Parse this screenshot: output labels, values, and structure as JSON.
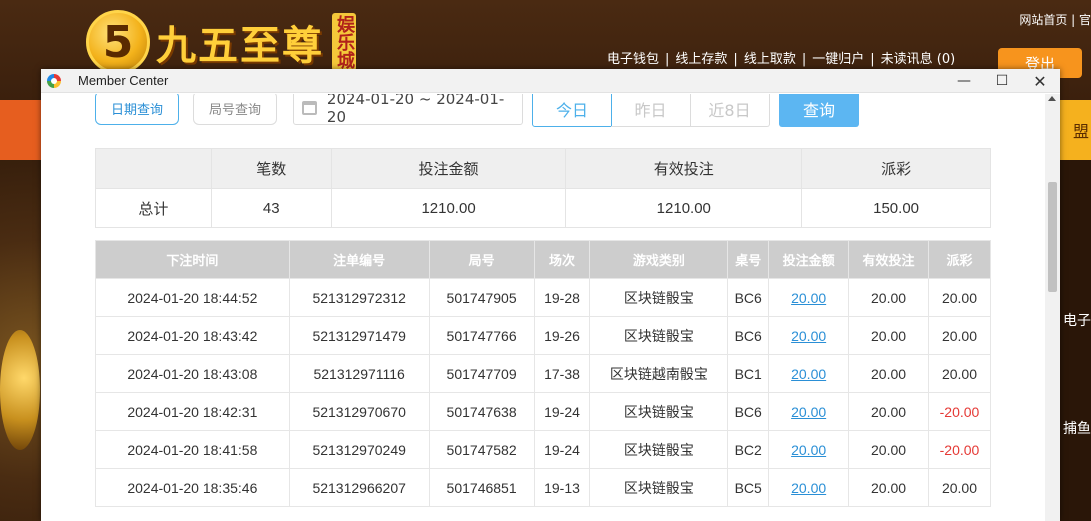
{
  "site": {
    "logo_mark": "5",
    "logo_text": "九五至尊",
    "logo_tag": "娱乐城",
    "top_links": "网站首页 | 官",
    "user_nav": [
      "电子钱包",
      "线上存款",
      "线上取款",
      "一键归户",
      "未读讯息 (0)"
    ],
    "logout_label": "登出",
    "band_right_text": "盟",
    "right_icon_labels": [
      "电子",
      "捕鱼"
    ]
  },
  "window": {
    "title": "Member Center",
    "minimize_icon": "—",
    "maximize_icon": "☐",
    "close_icon": "✕"
  },
  "filter": {
    "tab_date": "日期查询",
    "tab_round": "局号查询",
    "date_range": "2024-01-20 ~ 2024-01-20",
    "today": "今日",
    "yesterday": "昨日",
    "last8": "近8日",
    "query": "查询"
  },
  "summary": {
    "headers": [
      "",
      "笔数",
      "投注金额",
      "有效投注",
      "派彩"
    ],
    "row": [
      "总计",
      "43",
      "1210.00",
      "1210.00",
      "150.00"
    ]
  },
  "detail": {
    "headers": [
      "下注时间",
      "注单编号",
      "局号",
      "场次",
      "游戏类别",
      "桌号",
      "投注金额",
      "有效投注",
      "派彩"
    ],
    "rows": [
      [
        "2024-01-20 18:44:52",
        "521312972312",
        "501747905",
        "19-28",
        "区块链骰宝",
        "BC6",
        "20.00",
        "20.00",
        "20.00"
      ],
      [
        "2024-01-20 18:43:42",
        "521312971479",
        "501747766",
        "19-26",
        "区块链骰宝",
        "BC6",
        "20.00",
        "20.00",
        "20.00"
      ],
      [
        "2024-01-20 18:43:08",
        "521312971116",
        "501747709",
        "17-38",
        "区块链越南骰宝",
        "BC1",
        "20.00",
        "20.00",
        "20.00"
      ],
      [
        "2024-01-20 18:42:31",
        "521312970670",
        "501747638",
        "19-24",
        "区块链骰宝",
        "BC6",
        "20.00",
        "20.00",
        "-20.00"
      ],
      [
        "2024-01-20 18:41:58",
        "521312970249",
        "501747582",
        "19-24",
        "区块链骰宝",
        "BC2",
        "20.00",
        "20.00",
        "-20.00"
      ],
      [
        "2024-01-20 18:35:46",
        "521312966207",
        "501746851",
        "19-13",
        "区块链骰宝",
        "BC5",
        "20.00",
        "20.00",
        "20.00"
      ]
    ]
  },
  "colors": {
    "accent": "#4db0ea",
    "query_button": "#5cb6f2",
    "negative": "#e53935",
    "header_bg": "#cdcdcd",
    "orange_band": "#e65e1f"
  }
}
